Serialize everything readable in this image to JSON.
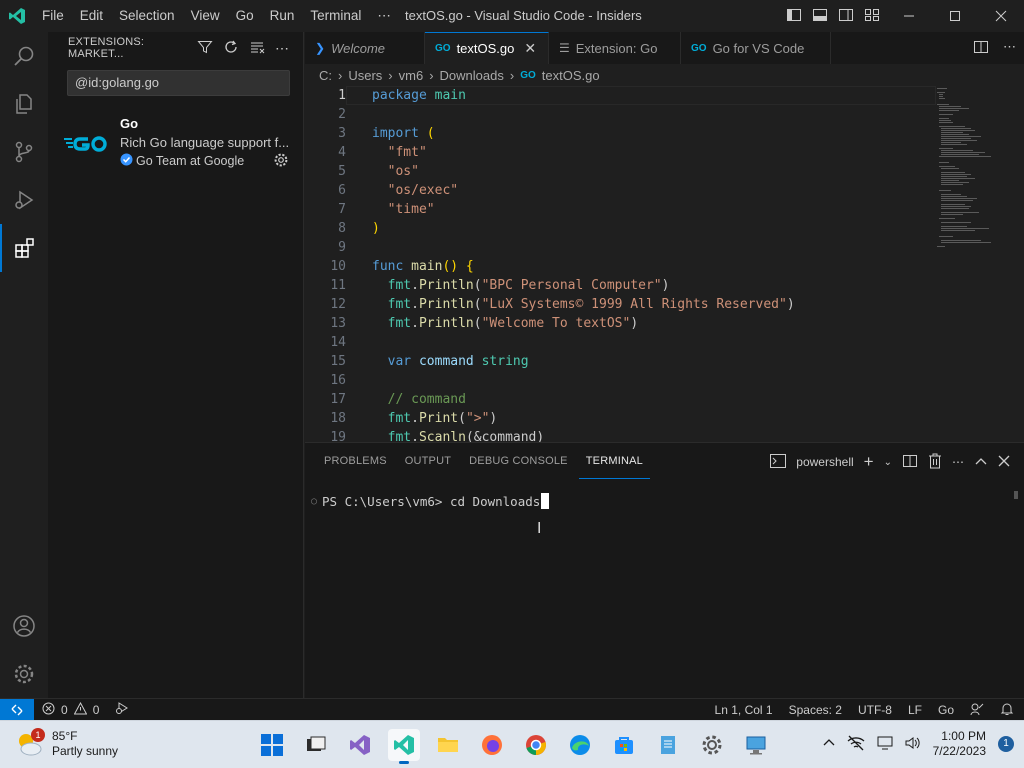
{
  "titlebar": {
    "menu": [
      "File",
      "Edit",
      "Selection",
      "View",
      "Go",
      "Run",
      "Terminal",
      "⋯"
    ],
    "title": "textOS.go - Visual Studio Code - Insiders"
  },
  "sidebar": {
    "title": "EXTENSIONS: MARKET...",
    "search_value": "@id:golang.go",
    "extension": {
      "name": "Go",
      "description": "Rich Go language support f...",
      "publisher": "Go Team at Google"
    }
  },
  "tabs": [
    {
      "label": "Welcome",
      "icon": "vscode-icon"
    },
    {
      "label": "textOS.go",
      "icon": "go-file-icon"
    },
    {
      "label": "Extension: Go",
      "icon": "extension-doc-icon"
    },
    {
      "label": "Go for VS Code",
      "icon": "go-file-icon"
    }
  ],
  "breadcrumb": [
    "C:",
    "Users",
    "vm6",
    "Downloads",
    "textOS.go"
  ],
  "code": {
    "line_numbers": [
      "1",
      "2",
      "3",
      "4",
      "5",
      "6",
      "7",
      "8",
      "9",
      "10",
      "11",
      "12",
      "13",
      "14",
      "15",
      "16",
      "17",
      "18",
      "19"
    ],
    "l1_kw": "package",
    "l1_name": " main",
    "l3_kw": "import",
    "l3_paren": " (",
    "l4": "\"fmt\"",
    "l5": "\"os\"",
    "l6": "\"os/exec\"",
    "l7": "\"time\"",
    "l8": ")",
    "l10_kw": "func",
    "l10_fn": " main",
    "l10_rest": "() {",
    "l11_pk": "fmt",
    "l11_fn": "Println",
    "l11_str": "\"BPC Personal Computer\"",
    "l12_pk": "fmt",
    "l12_fn": "Println",
    "l12_str": "\"LuX Systems© 1999 All Rights Reserved\"",
    "l13_pk": "fmt",
    "l13_fn": "Println",
    "l13_str": "\"Welcome To textOS\"",
    "l15_kw": "var",
    "l15_var": " command",
    "l15_ty": " string",
    "l17_cm": "// command",
    "l18_pk": "fmt",
    "l18_fn": "Print",
    "l18_str": "\">\"",
    "l19_pk": "fmt",
    "l19_fn": "Scanln",
    "l19_arg": "(&command)"
  },
  "panel": {
    "tabs": [
      "PROBLEMS",
      "OUTPUT",
      "DEBUG CONSOLE",
      "TERMINAL"
    ],
    "shell": "powershell",
    "terminal_prompt": "PS C:\\Users\\vm6> ",
    "terminal_input": "cd Downloads"
  },
  "statusbar": {
    "errors": "0",
    "warnings": "0",
    "position": "Ln 1, Col 1",
    "spaces": "Spaces: 2",
    "encoding": "UTF-8",
    "eol": "LF",
    "language": "Go"
  },
  "taskbar": {
    "temp": "85°F",
    "weather": "Partly sunny",
    "weather_badge": "1",
    "time": "1:00 PM",
    "date": "7/22/2023",
    "notifications": "1"
  },
  "colors": {
    "accent": "#0078d4",
    "keyword": "#569cd6",
    "string": "#ce9178",
    "function": "#dcdcaa",
    "comment": "#6a9955",
    "go_blue": "#00add8"
  }
}
